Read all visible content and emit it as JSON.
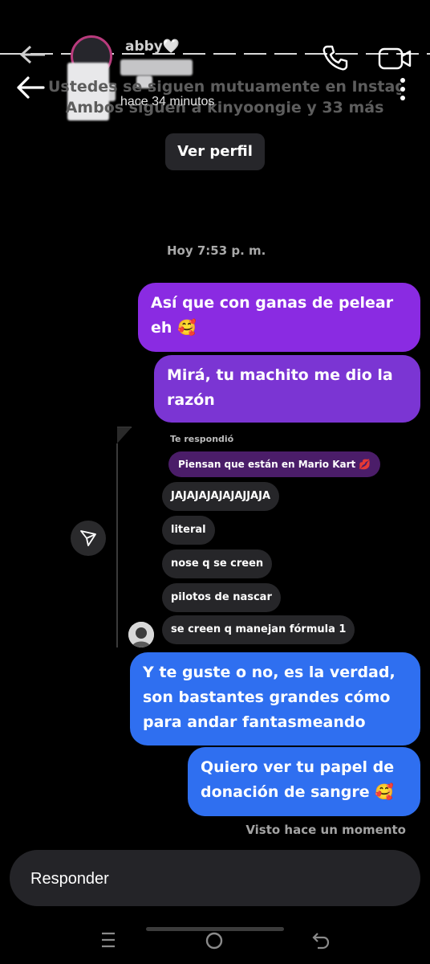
{
  "header": {
    "name": "abby🤍",
    "status": "hace 34 minutos",
    "background_text_line1": "Ustedes se siguen mutuamente en Instagram",
    "background_text_line2": "Ambos siguen a kinyoongie y 33 más"
  },
  "profile_button": {
    "label": "Ver perfil"
  },
  "timestamp": "Hoy 7:53 p. m.",
  "messages_sent_top": [
    {
      "lines": [
        "Así que con ganas de pelear",
        "eh 🥰"
      ]
    },
    {
      "lines": [
        "Mirá, tu machito me dio la",
        "razón"
      ]
    }
  ],
  "shared_post": {
    "reply_label": "Te respondió",
    "quoted_message": "Piensan que están en Mario Kart 💋",
    "received_messages": [
      "JAJAJAJAJAJAJJAJA",
      "literal",
      "nose q se creen",
      "pilotos de nascar",
      "se creen q manejan fórmula 1"
    ]
  },
  "messages_sent_bottom": [
    {
      "lines": [
        "Y te guste o no, es la verdad,",
        "son bastantes grandes cómo",
        "para andar fantasmeando"
      ]
    },
    {
      "lines": [
        "Quiero ver tu papel de",
        "donación de sangre 🥰"
      ]
    }
  ],
  "seen_status": "Visto hace un momento",
  "composer": {
    "placeholder": "Responder"
  },
  "icons": {
    "back": "arrow-left-icon",
    "call": "phone-icon",
    "video": "video-camera-icon",
    "more": "more-vertical-icon",
    "share": "send-icon",
    "nav_recents": "recents-icon",
    "nav_home": "home-icon",
    "nav_back": "back-nav-icon"
  },
  "colors": {
    "background": "#000000",
    "sent_purple": "#8a2be2",
    "sent_blue": "#2f6ff0",
    "received": "#262629",
    "composer": "#242428"
  }
}
